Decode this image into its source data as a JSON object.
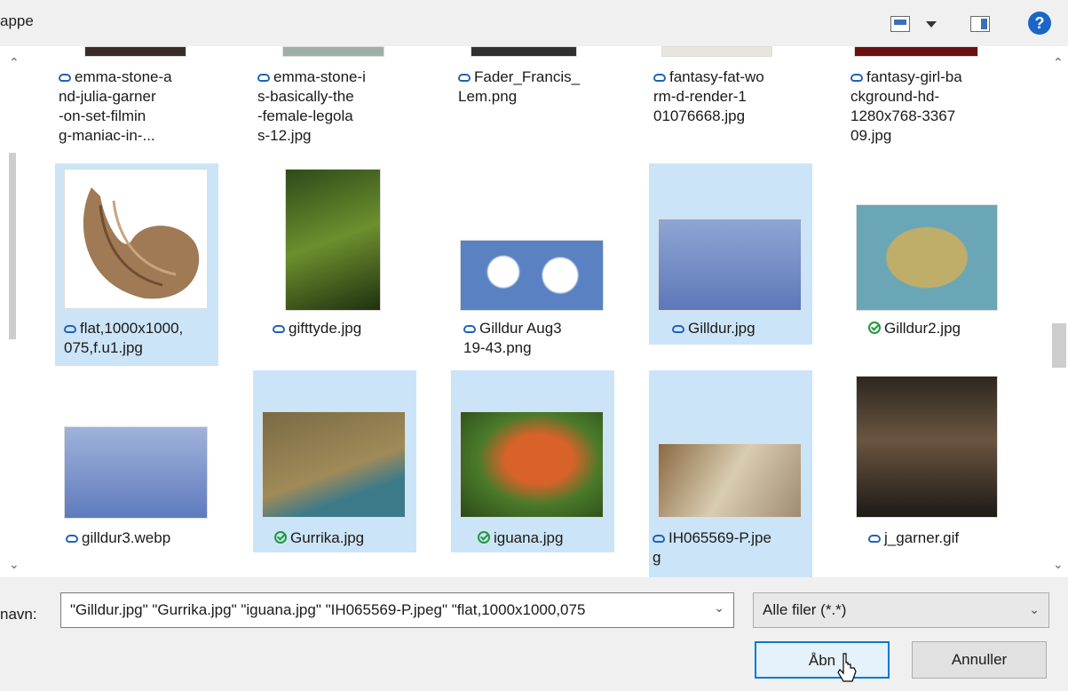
{
  "toolbar": {
    "crumb": "appe",
    "help": "?"
  },
  "tiles": [
    {
      "label": "emma-stone-a\nnd-julia-garner\n-on-set-filmin\ng-maniac-in-...",
      "status": "cloud"
    },
    {
      "label": "emma-stone-i\ns-basically-the\n-female-legola\ns-12.jpg",
      "status": "cloud"
    },
    {
      "label": "Fader_Francis_\nLem.png",
      "status": "cloud"
    },
    {
      "label": "fantasy-fat-wo\nrm-d-render-1\n01076668.jpg",
      "status": "cloud"
    },
    {
      "label": "fantasy-girl-ba\nckground-hd-\n1280x768-3367\n09.jpg",
      "status": "cloud"
    },
    {
      "label": "flat,1000x1000,\n075,f.u1.jpg",
      "status": "cloud"
    },
    {
      "label": "gifttyde.jpg",
      "status": "cloud"
    },
    {
      "label": "Gilldur Aug3\n19-43.png",
      "status": "cloud"
    },
    {
      "label": "Gilldur.jpg",
      "status": "cloud"
    },
    {
      "label": "Gilldur2.jpg",
      "status": "check"
    },
    {
      "label": "gilldur3.webp",
      "status": "cloud"
    },
    {
      "label": "Gurrika.jpg",
      "status": "check"
    },
    {
      "label": "iguana.jpg",
      "status": "check"
    },
    {
      "label": "IH065569-P.jpe\ng",
      "status": "cloud"
    },
    {
      "label": "j_garner.gif",
      "status": "cloud"
    }
  ],
  "footer": {
    "filename_label": "navn:",
    "filename_value": "\"Gilldur.jpg\" \"Gurrika.jpg\" \"iguana.jpg\" \"IH065569-P.jpeg\" \"flat,1000x1000,075",
    "filter_value": "Alle filer (*.*)",
    "open_label": "Åbn",
    "cancel_label": "Annuller"
  },
  "colors": {
    "selection": "#cce4f7",
    "cloud": "#1f63b8",
    "check": "#1e9a3a",
    "accent": "#0078d7"
  }
}
